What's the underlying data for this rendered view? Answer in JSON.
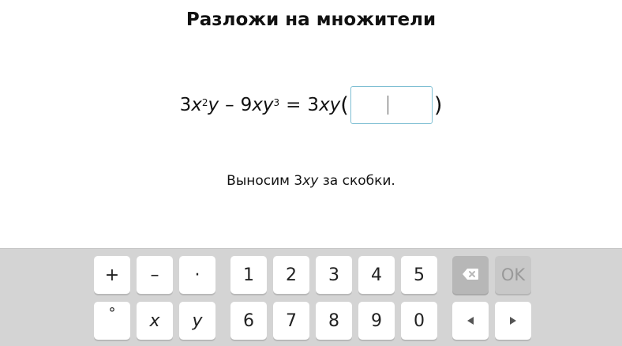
{
  "task": {
    "title": "Разложи на множители"
  },
  "equation": {
    "coef1": "3",
    "var1": "x",
    "exp1": "2",
    "var2": "y",
    "minus": "–",
    "coef2": "9",
    "var3": "xy",
    "exp2": "3",
    "equals": "=",
    "coef3": "3",
    "var4": "xy",
    "open_paren": "(",
    "close_paren": ")",
    "answer_value": ""
  },
  "hint": {
    "prefix": "Выносим",
    "coef": "3",
    "vars": "xy",
    "suffix": "за скобки."
  },
  "keyboard": {
    "row1": {
      "plus": "+",
      "minus": "–",
      "dot": "·",
      "k1": "1",
      "k2": "2",
      "k3": "3",
      "k4": "4",
      "k5": "5",
      "ok": "OK"
    },
    "row2": {
      "degree": "°",
      "x": "x",
      "y": "y",
      "k6": "6",
      "k7": "7",
      "k8": "8",
      "k9": "9",
      "k0": "0"
    },
    "icons": {
      "backspace": "backspace-icon",
      "left": "left-arrow-icon",
      "right": "right-arrow-icon"
    }
  }
}
